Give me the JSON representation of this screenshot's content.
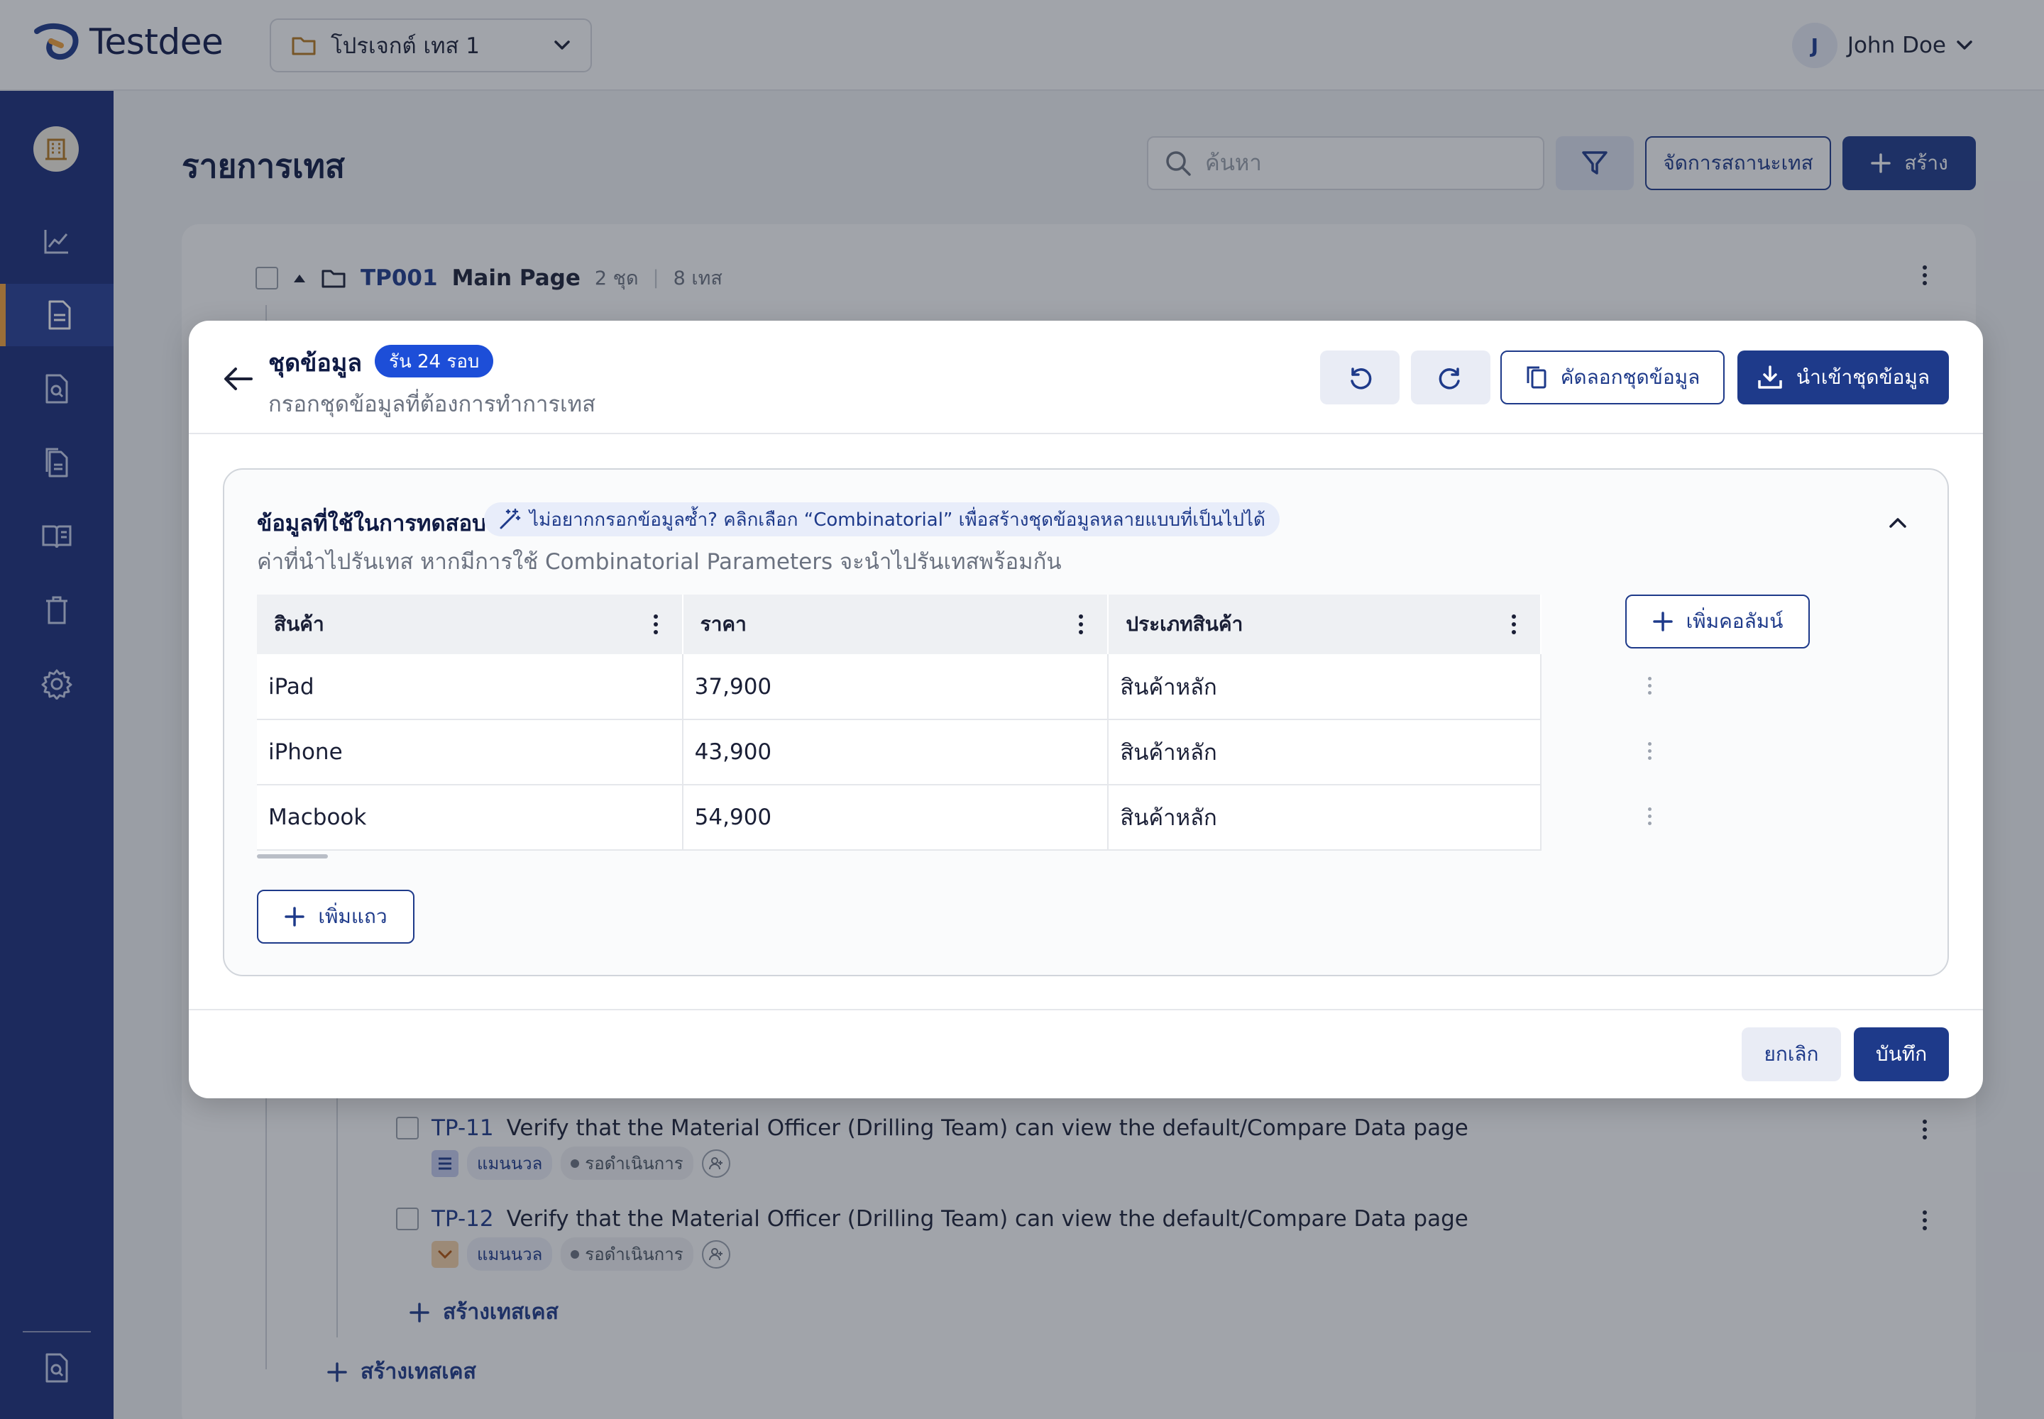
{
  "app": {
    "name": "Testdee"
  },
  "header": {
    "project_label": "โปรเจกต์ เทส 1",
    "user_initial": "J",
    "user_name": "John Doe"
  },
  "sidebar": {
    "items": [
      {
        "icon": "chart-line-icon"
      },
      {
        "icon": "document-icon",
        "active": true
      },
      {
        "icon": "document-search-icon"
      },
      {
        "icon": "documents-copy-icon"
      },
      {
        "icon": "book-open-icon"
      },
      {
        "icon": "trash-icon"
      },
      {
        "icon": "gear-icon"
      }
    ],
    "bottom_icon": "document-search-icon"
  },
  "page": {
    "title": "รายการเทส",
    "search_placeholder": "ค้นหา",
    "manage_status_label": "จัดการสถานะเทส",
    "create_label": "สร้าง"
  },
  "suite": {
    "code": "TP001",
    "name": "Main Page",
    "sets": "2 ชุด",
    "tests": "8 เทส"
  },
  "cases": [
    {
      "id": "TP-11",
      "title": "Verify that the Material Officer (Drilling Team) can view the default/Compare Data page",
      "type_label": "แมนนวล",
      "status": "รอดำเนินการ",
      "type_color": "#c7cdf0"
    },
    {
      "id": "TP-12",
      "title": "Verify that the Material Officer (Drilling Team) can view the default/Compare Data page",
      "type_label": "แมนนวล",
      "status": "รอดำเนินการ",
      "type_color": "#f6d2a8"
    }
  ],
  "add_case_label": "สร้างเทสเคส",
  "modal": {
    "title": "ชุดข้อมูล",
    "run_badge": "รัน 24 รอบ",
    "subtitle": "กรอกชุดข้อมูลที่ต้องการทำการเทส",
    "copy_label": "คัดลอกชุดข้อมูล",
    "import_label": "นำเข้าชุดข้อมูล",
    "section_title": "ข้อมูลที่ใช้ในการทดสอบ",
    "hint": "ไม่อยากกรอกข้อมูลซ้ำ? คลิกเลือก “Combinatorial” เพื่อสร้างชุดข้อมูลหลายแบบที่เป็นไปได้",
    "section_desc": "ค่าที่นำไปรันเทส หากมีการใช้ Combinatorial Parameters จะนำไปรันเทสพร้อมกัน",
    "table": {
      "columns": [
        "สินค้า",
        "ราคา",
        "ประเภทสินค้า"
      ],
      "rows": [
        [
          "iPad",
          "37,900",
          "สินค้าหลัก"
        ],
        [
          "iPhone",
          "43,900",
          "สินค้าหลัก"
        ],
        [
          "Macbook",
          "54,900",
          "สินค้าหลัก"
        ]
      ]
    },
    "add_column_label": "เพิ่มคอลัมน์",
    "add_row_label": "เพิ่มแถว",
    "cancel_label": "ยกเลิก",
    "save_label": "บันทึก"
  },
  "colors": {
    "primary": "#1e3a8a",
    "sidebar": "#1a2e7a",
    "accent": "#f3a23b",
    "badge": "#1d4ed8"
  }
}
